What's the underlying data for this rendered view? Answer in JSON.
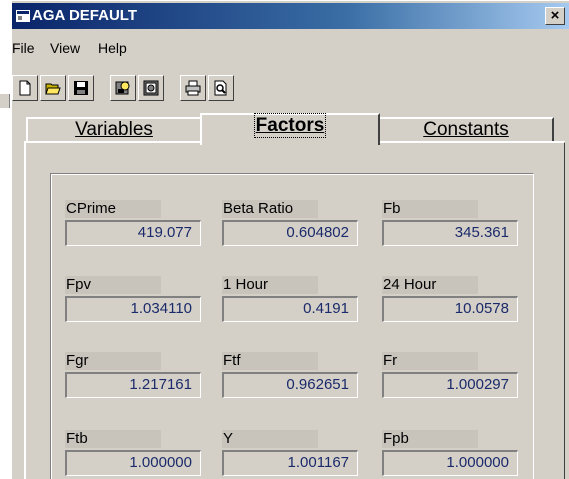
{
  "window": {
    "title": "AGA DEFAULT",
    "close_glyph": "×"
  },
  "menu": {
    "file": "File",
    "view": "View",
    "help": "Help"
  },
  "toolbar": {
    "buttons": [
      "new-icon",
      "open-icon",
      "save-icon",
      "calculate-icon",
      "settings-icon",
      "print-icon",
      "print-preview-icon"
    ]
  },
  "tabs": {
    "variables": "Variables",
    "factors": "Factors",
    "constants": "Constants",
    "active": "Factors"
  },
  "factors": [
    {
      "label": "CPrime",
      "value": "419.077"
    },
    {
      "label": "Beta Ratio",
      "value": "0.604802"
    },
    {
      "label": "Fb",
      "value": "345.361"
    },
    {
      "label": "Fpv",
      "value": "1.034110"
    },
    {
      "label": "1 Hour",
      "value": "0.4191"
    },
    {
      "label": "24 Hour",
      "value": "10.0578"
    },
    {
      "label": "Fgr",
      "value": "1.217161"
    },
    {
      "label": "Ftf",
      "value": "0.962651"
    },
    {
      "label": "Fr",
      "value": "1.000297"
    },
    {
      "label": "Ftb",
      "value": "1.000000"
    },
    {
      "label": "Y",
      "value": "1.001167"
    },
    {
      "label": "Fpb",
      "value": "1.000000"
    }
  ]
}
